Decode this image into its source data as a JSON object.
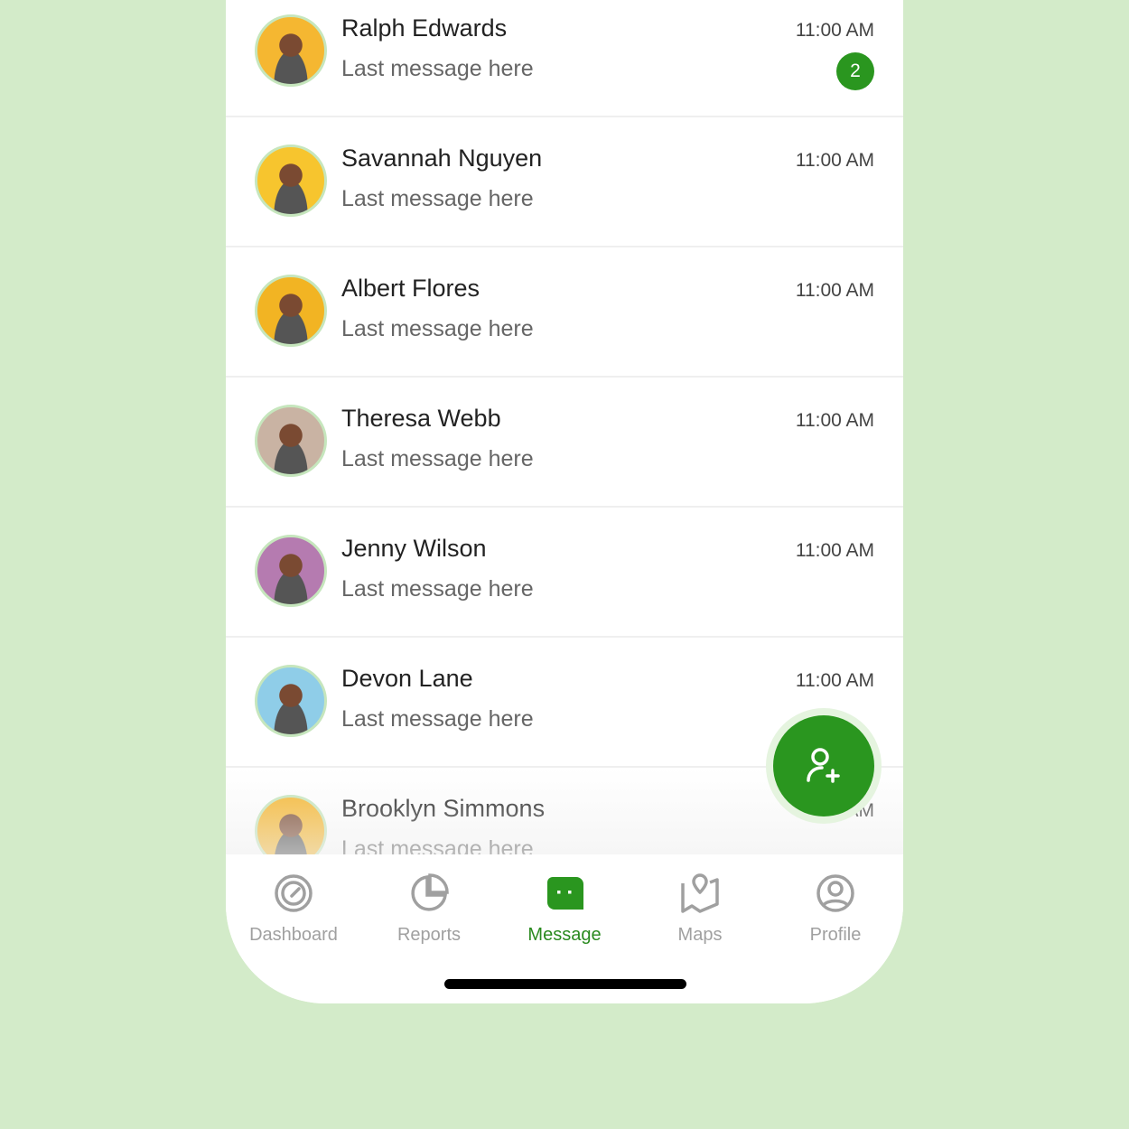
{
  "accent": "#2a961f",
  "chats": [
    {
      "name": "Ralph Edwards",
      "message": "Last message here",
      "time": "11:00 AM",
      "unread": "2",
      "avatar_color": "#f5b731"
    },
    {
      "name": "Savannah Nguyen",
      "message": "Last message here",
      "time": "11:00 AM",
      "avatar_color": "#f7c52e"
    },
    {
      "name": "Albert Flores",
      "message": "Last message here",
      "time": "11:00 AM",
      "avatar_color": "#f2b423"
    },
    {
      "name": "Theresa Webb",
      "message": "Last message here",
      "time": "11:00 AM",
      "avatar_color": "#c9b3a3"
    },
    {
      "name": "Jenny Wilson",
      "message": "Last message here",
      "time": "11:00 AM",
      "avatar_color": "#b57bb0"
    },
    {
      "name": "Devon Lane",
      "message": "Last message here",
      "time": "11:00 AM",
      "avatar_color": "#8fcde8"
    },
    {
      "name": "Brooklyn Simmons",
      "message": "Last message here",
      "time": "11:00 AM",
      "avatar_color": "#f5b731"
    }
  ],
  "fab": {
    "icon": "add-user-icon"
  },
  "nav": [
    {
      "label": "Dashboard",
      "icon": "speedometer-icon"
    },
    {
      "label": "Reports",
      "icon": "pie-chart-icon"
    },
    {
      "label": "Message",
      "icon": "chat-icon",
      "active": true
    },
    {
      "label": "Maps",
      "icon": "map-icon"
    },
    {
      "label": "Profile",
      "icon": "profile-icon"
    }
  ]
}
